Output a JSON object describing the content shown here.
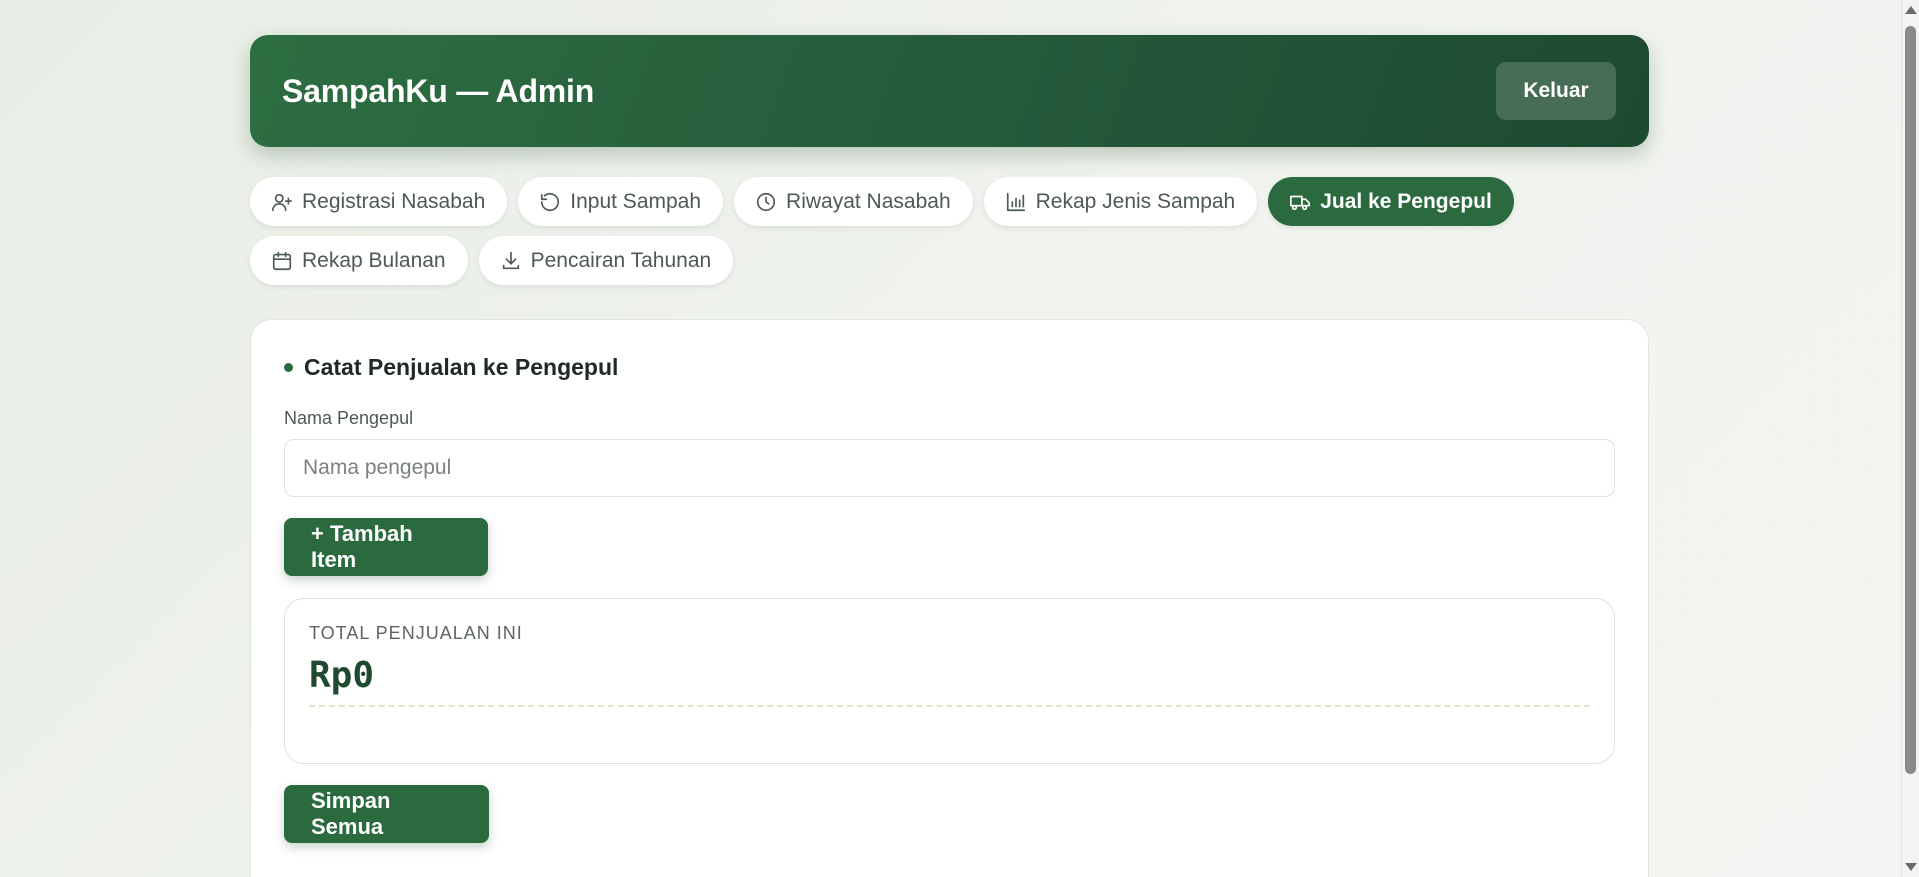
{
  "header": {
    "title": "SampahKu — Admin",
    "logout_label": "Keluar"
  },
  "tabs": [
    {
      "label": "Registrasi Nasabah",
      "icon": "user-plus-icon",
      "active": false
    },
    {
      "label": "Input Sampah",
      "icon": "refresh-icon",
      "active": false
    },
    {
      "label": "Riwayat Nasabah",
      "icon": "clock-icon",
      "active": false
    },
    {
      "label": "Rekap Jenis Sampah",
      "icon": "bar-chart-icon",
      "active": false
    },
    {
      "label": "Jual ke Pengepul",
      "icon": "truck-icon",
      "active": true
    },
    {
      "label": "Rekap Bulanan",
      "icon": "calendar-icon",
      "active": false
    },
    {
      "label": "Pencairan Tahunan",
      "icon": "download-icon",
      "active": false
    }
  ],
  "form": {
    "section_title": "Catat Penjualan ke Pengepul",
    "collector_label": "Nama Pengepul",
    "collector_placeholder": "Nama pengepul",
    "collector_value": "",
    "add_item_label": "+ Tambah Item",
    "total_label": "TOTAL PENJUALAN INI",
    "total_value": "Rp0",
    "save_label": "Simpan Semua"
  },
  "colors": {
    "primary": "#2a6a3e",
    "header_dark": "#1e4a30",
    "total_text": "#1f4a2f"
  }
}
